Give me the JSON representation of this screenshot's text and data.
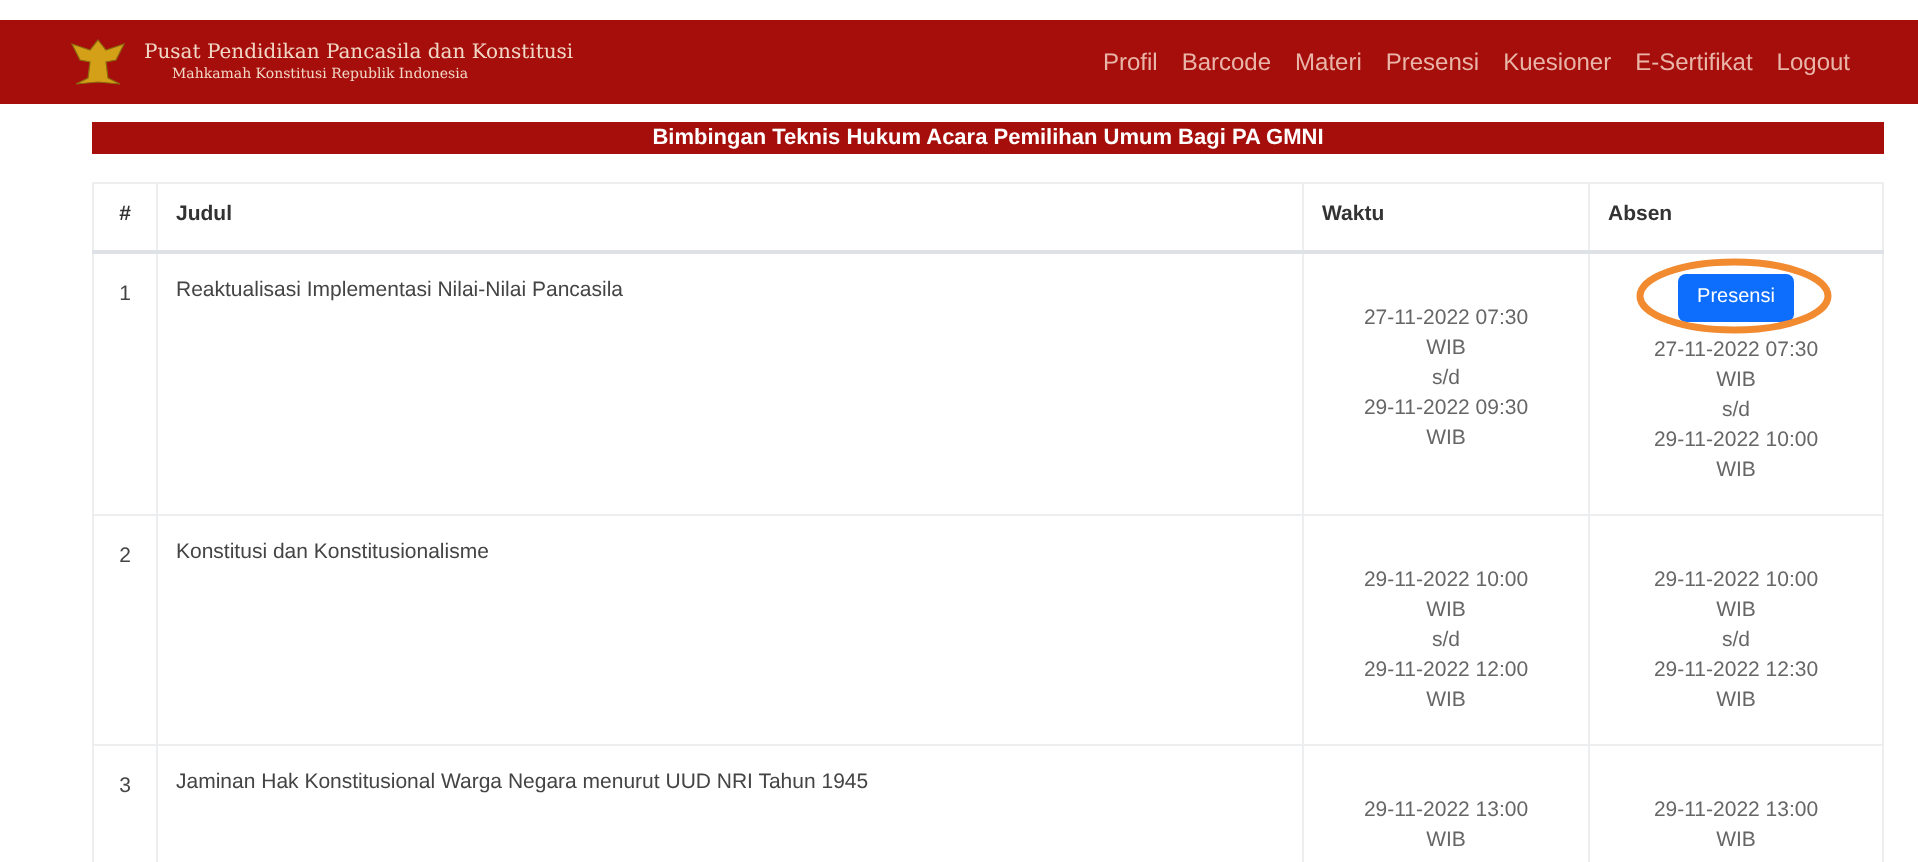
{
  "header": {
    "title": "Pusat Pendidikan Pancasila dan Konstitusi",
    "subtitle": "Mahkamah Konstitusi Republik Indonesia",
    "nav": [
      "Profil",
      "Barcode",
      "Materi",
      "Presensi",
      "Kuesioner",
      "E-Sertifikat",
      "Logout"
    ]
  },
  "banner": "Bimbingan Teknis Hukum Acara Pemilihan Umum Bagi PA GMNI",
  "table": {
    "columns": [
      "#",
      "Judul",
      "Waktu",
      "Absen"
    ],
    "rows": [
      {
        "no": "1",
        "judul": "Reaktualisasi Implementasi Nilai-Nilai Pancasila",
        "waktu": [
          "27-11-2022 07:30",
          "WIB",
          "s/d",
          "29-11-2022 09:30",
          "WIB"
        ],
        "button": "Presensi",
        "highlighted": true,
        "absen": [
          "27-11-2022 07:30",
          "WIB",
          "s/d",
          "29-11-2022 10:00",
          "WIB"
        ]
      },
      {
        "no": "2",
        "judul": "Konstitusi dan Konstitusionalisme",
        "waktu": [
          "29-11-2022 10:00",
          "WIB",
          "s/d",
          "29-11-2022 12:00",
          "WIB"
        ],
        "absen": [
          "29-11-2022 10:00",
          "WIB",
          "s/d",
          "29-11-2022 12:30",
          "WIB"
        ]
      },
      {
        "no": "3",
        "judul": "Jaminan Hak Konstitusional Warga Negara menurut UUD NRI Tahun 1945",
        "waktu": [
          "29-11-2022 13:00",
          "WIB"
        ],
        "absen": [
          "29-11-2022 13:00",
          "WIB"
        ]
      }
    ]
  }
}
